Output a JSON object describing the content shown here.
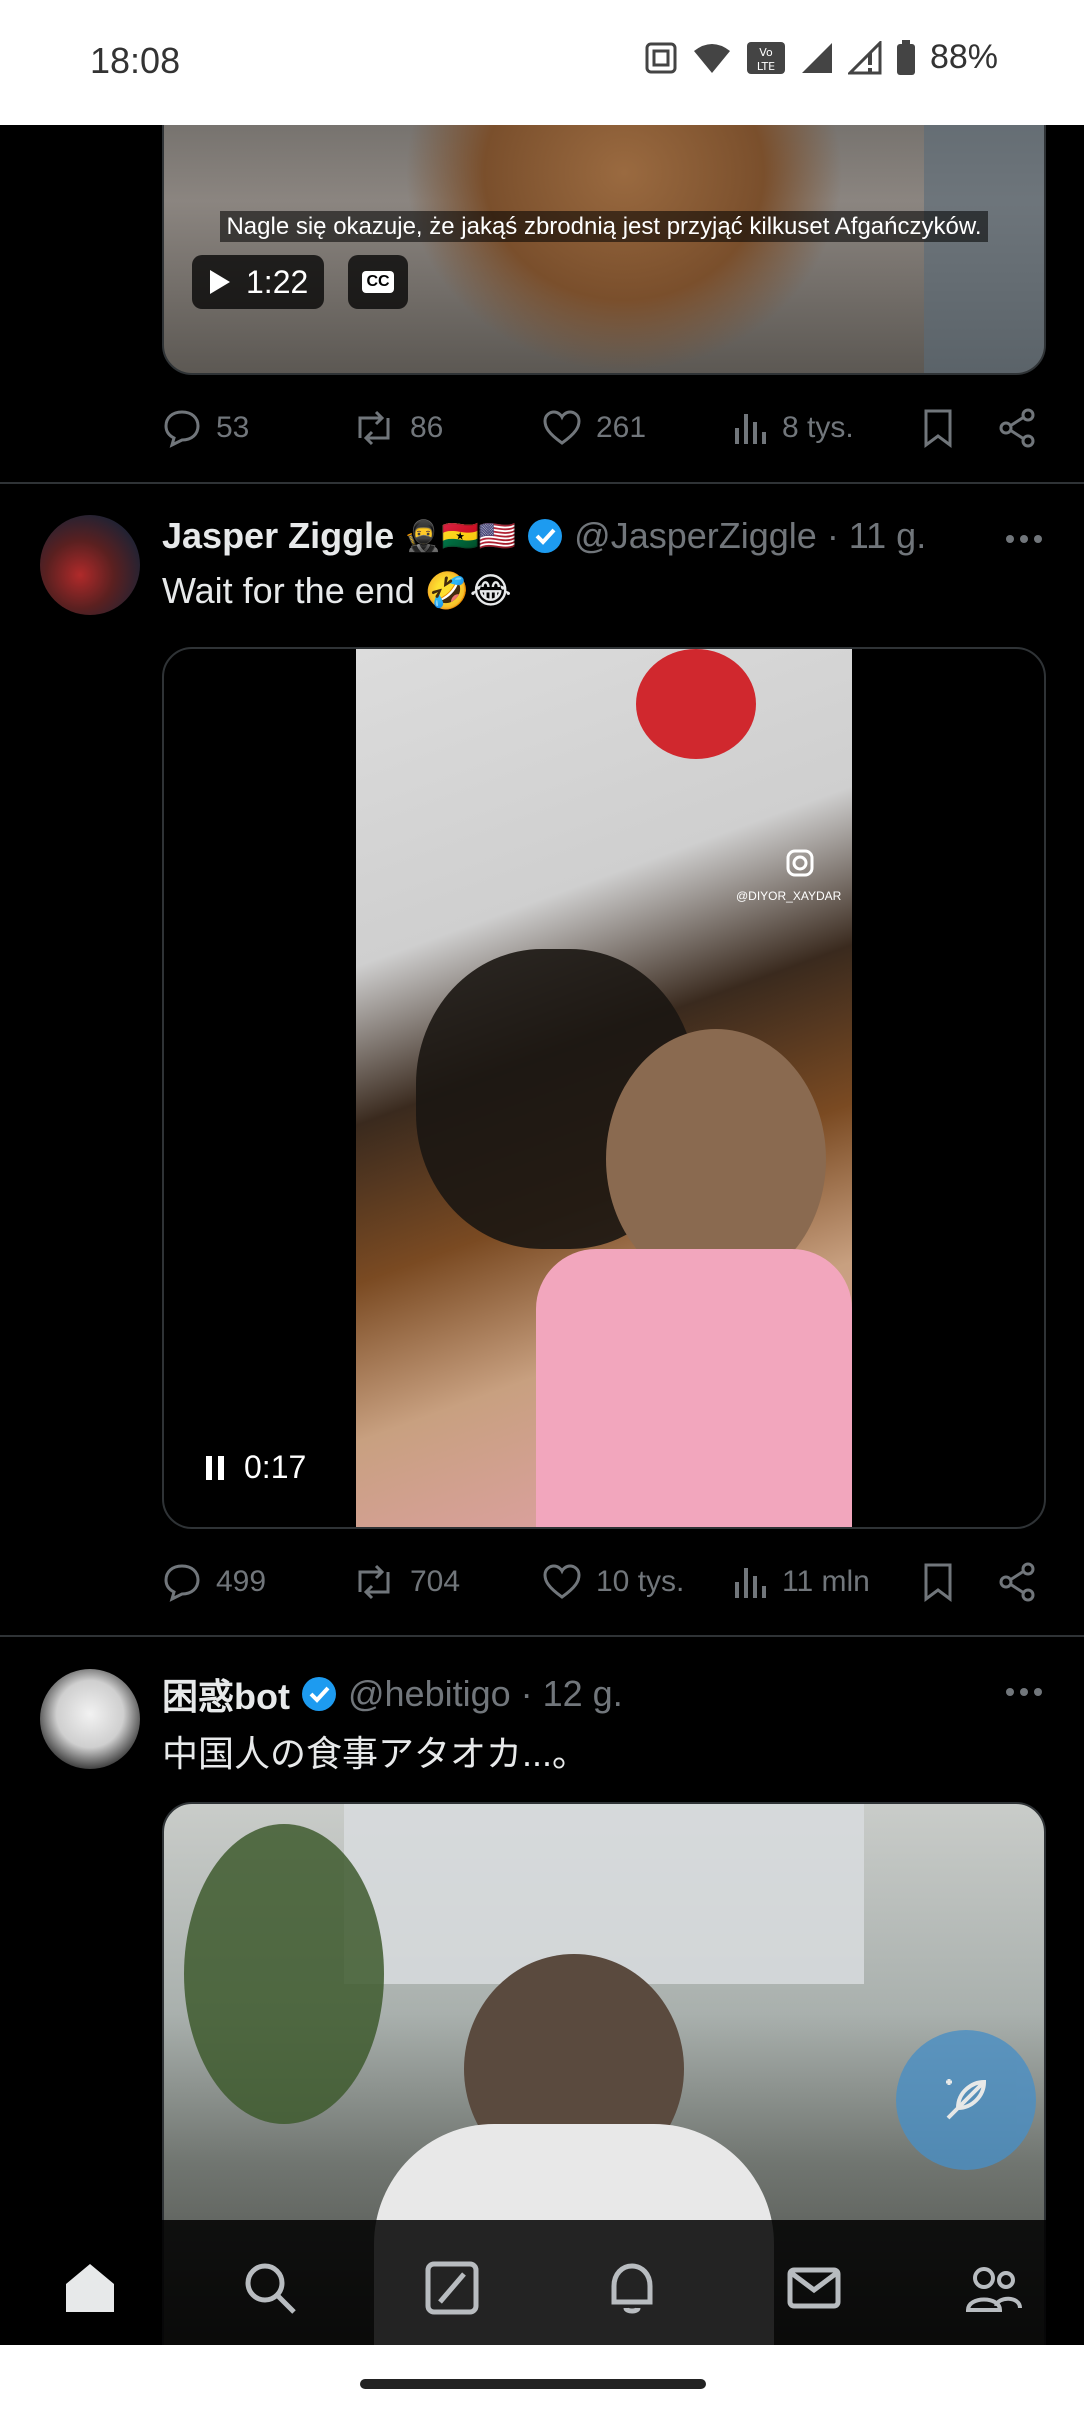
{
  "status_bar": {
    "time": "18:08",
    "battery": "88%",
    "volte": "Vo LTE"
  },
  "tweet1": {
    "video_caption": "Nagle się okazuje, że jakąś zbrodnią jest przyjąć kilkuset Afgańczyków.",
    "duration": "1:22",
    "cc_label": "CC",
    "replies": "53",
    "reposts": "86",
    "likes": "261",
    "views": "8 tys."
  },
  "tweet2": {
    "name": "Jasper Ziggle",
    "emojis": "🥷🇬🇭🇺🇸",
    "handle": "@JasperZiggle",
    "time": "· 11 g.",
    "text": "Wait for the end 🤣😂",
    "watermark": "@DIYOR_XAYDAR",
    "video_time": "0:17",
    "replies": "499",
    "reposts": "704",
    "likes": "10 tys.",
    "views": "11 mln"
  },
  "tweet3": {
    "name": "困惑bot",
    "handle": "@hebitigo",
    "time": "· 12 g.",
    "text": "中国人の食事アタオカ...。"
  },
  "icons": {
    "reply": "reply-icon",
    "repost": "repost-icon",
    "like": "heart-icon",
    "views": "views-icon",
    "bookmark": "bookmark-icon",
    "share": "share-icon"
  },
  "colors": {
    "background": "#000000",
    "text": "#e7e9ea",
    "muted": "#71767b",
    "verified": "#1d9bf0",
    "divider": "#2f3336"
  }
}
